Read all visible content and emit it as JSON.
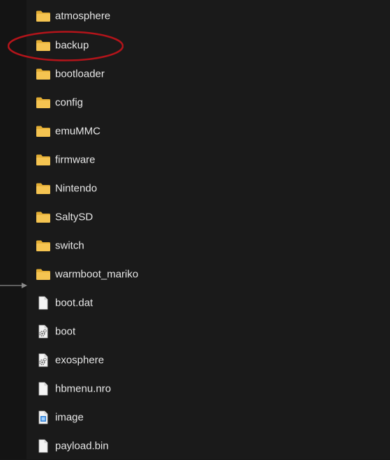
{
  "colors": {
    "background": "#171717",
    "text": "#e6e6e6",
    "folder": "#f5c451",
    "annotation_circle": "#b3141a",
    "arrow": "#8a8a8a"
  },
  "items": [
    {
      "name": "atmosphere",
      "type": "folder",
      "icon": "folder-icon"
    },
    {
      "name": "backup",
      "type": "folder",
      "icon": "folder-icon"
    },
    {
      "name": "bootloader",
      "type": "folder",
      "icon": "folder-icon"
    },
    {
      "name": "config",
      "type": "folder",
      "icon": "folder-icon"
    },
    {
      "name": "emuMMC",
      "type": "folder",
      "icon": "folder-icon"
    },
    {
      "name": "firmware",
      "type": "folder",
      "icon": "folder-icon"
    },
    {
      "name": "Nintendo",
      "type": "folder",
      "icon": "folder-icon"
    },
    {
      "name": "SaltySD",
      "type": "folder",
      "icon": "folder-icon"
    },
    {
      "name": "switch",
      "type": "folder",
      "icon": "folder-icon"
    },
    {
      "name": "warmboot_mariko",
      "type": "folder",
      "icon": "folder-icon"
    },
    {
      "name": "boot.dat",
      "type": "file",
      "icon": "file-icon"
    },
    {
      "name": "boot",
      "type": "system-file",
      "icon": "gear-file-icon"
    },
    {
      "name": "exosphere",
      "type": "system-file",
      "icon": "gear-file-icon"
    },
    {
      "name": "hbmenu.nro",
      "type": "file",
      "icon": "file-icon"
    },
    {
      "name": "image",
      "type": "image-file",
      "icon": "image-file-icon"
    },
    {
      "name": "payload.bin",
      "type": "file",
      "icon": "file-icon"
    }
  ],
  "annotation": {
    "highlighted_item": "backup",
    "shape": "circle"
  }
}
